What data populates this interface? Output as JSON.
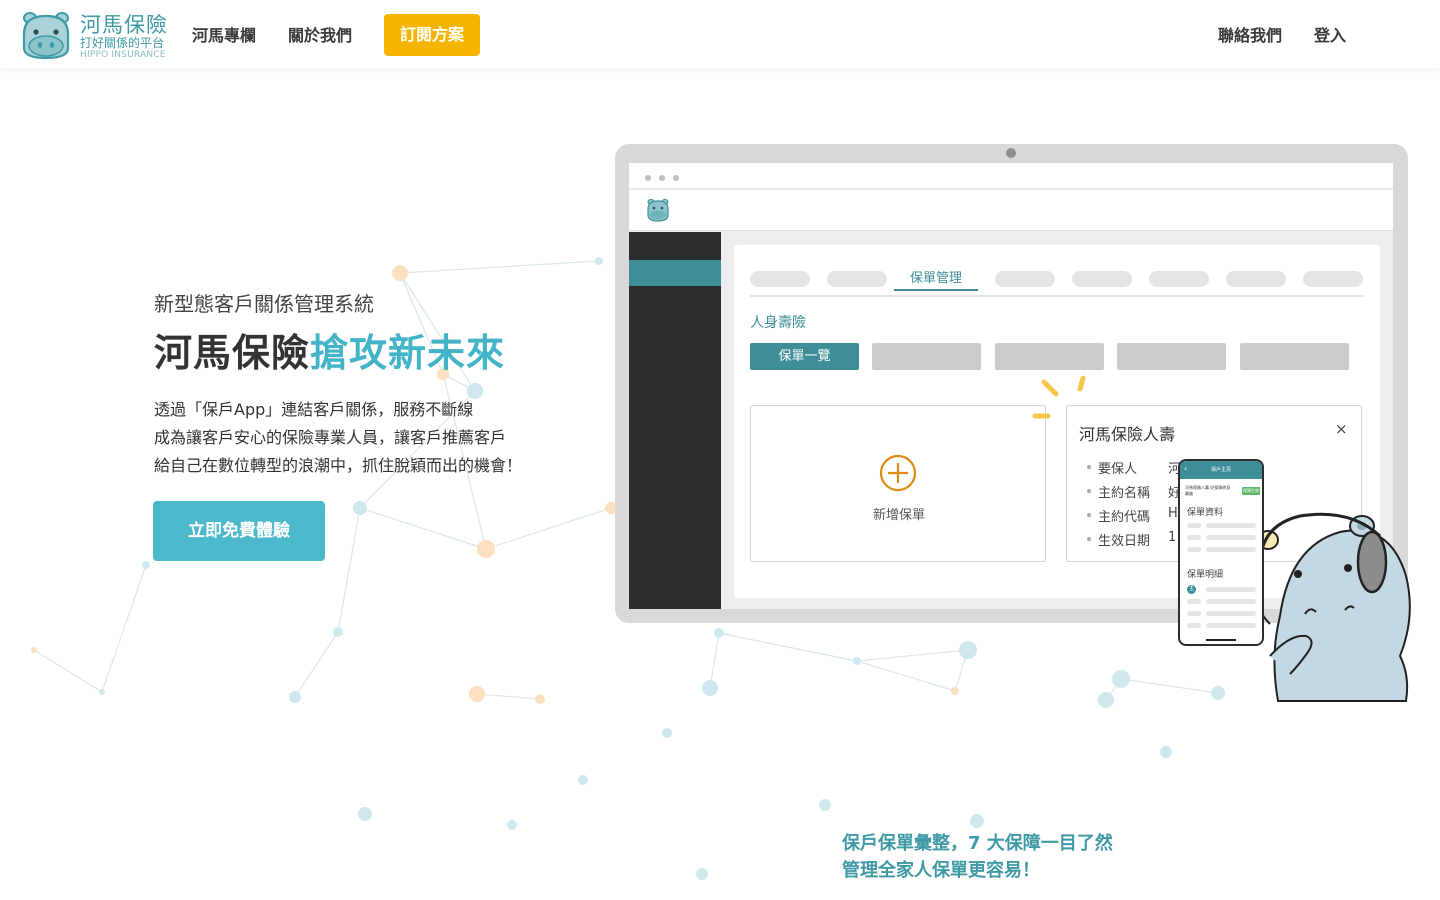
{
  "brand": {
    "name": "河馬保險",
    "slogan": "打好關係的平台",
    "name_en": "HIPPO INSURANCE",
    "colors": {
      "teal": "#3f9aa6",
      "accent_blue": "#4bb8cc",
      "cta_yellow": "#f4b400",
      "app_teal": "#3d8e99"
    }
  },
  "nav": {
    "column": "河馬專欄",
    "about": "關於我們",
    "subscribe": "訂閱方案",
    "contact": "聯絡我們",
    "login": "登入"
  },
  "hero": {
    "subtitle": "新型態客戶關係管理系統",
    "title_main": "河馬保險",
    "title_accent": "搶攻新未來",
    "desc": [
      "透過「保戶App」連結客戶關係，服務不斷線",
      "成為讓客戶安心的保險專業人員，讓客戶推薦客戶",
      "給自己在數位轉型的浪潮中，抓住脫穎而出的機會！"
    ],
    "cta": "立即免費體驗"
  },
  "app_preview": {
    "active_tab": "保單管理",
    "section": "人身壽險",
    "active_pill": "保單一覽",
    "add_card_label": "新增保單",
    "add_icon": "plus-circle-icon",
    "policy_card": {
      "title": "河馬保險人壽",
      "close": "×",
      "rows": [
        {
          "label": "要保人",
          "value": "河"
        },
        {
          "label": "主約名稱",
          "value": "好"
        },
        {
          "label": "主約代碼",
          "value": "H"
        },
        {
          "label": "生效日期",
          "value": "1"
        }
      ]
    }
  },
  "phone_preview": {
    "header": "保戶主頁",
    "back": "‹",
    "policy_name_lines": [
      "河馬保險人壽 好保障終身",
      "壽險"
    ],
    "badge": "保障生效",
    "section_info": "保單資料",
    "section_detail": "保單明細",
    "detail_marker": "主"
  },
  "feature": {
    "lines": [
      "保戶保單彙整，7 大保障一目了然",
      "管理全家人保單更容易！"
    ]
  }
}
